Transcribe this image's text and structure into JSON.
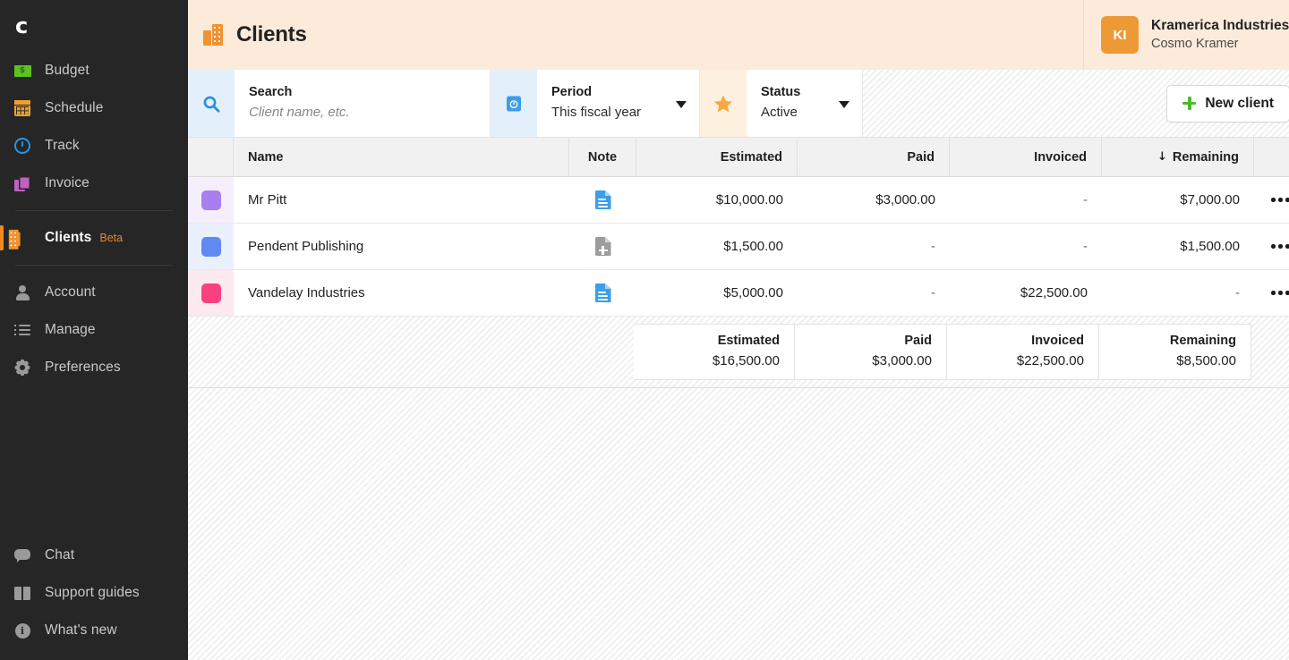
{
  "sidebar": {
    "logo": "c",
    "primary_items": [
      {
        "label": "Budget",
        "icon": "money-icon"
      },
      {
        "label": "Schedule",
        "icon": "calendar-icon"
      },
      {
        "label": "Track",
        "icon": "stopwatch-icon"
      },
      {
        "label": "Invoice",
        "icon": "invoice-icon"
      }
    ],
    "active_item": {
      "label": "Clients",
      "badge": "Beta",
      "icon": "building-icon"
    },
    "secondary_items": [
      {
        "label": "Account",
        "icon": "person-icon"
      },
      {
        "label": "Manage",
        "icon": "list-icon"
      },
      {
        "label": "Preferences",
        "icon": "gear-icon"
      }
    ],
    "bottom_items": [
      {
        "label": "Chat",
        "icon": "chat-icon"
      },
      {
        "label": "Support guides",
        "icon": "book-icon"
      },
      {
        "label": "What's new",
        "icon": "info-icon"
      }
    ]
  },
  "header": {
    "title": "Clients",
    "org_initials": "KI",
    "org_name": "Kramerica Industries",
    "user_name": "Cosmo Kramer"
  },
  "filters": {
    "search": {
      "label": "Search",
      "placeholder": "Client name, etc.",
      "value": ""
    },
    "period": {
      "label": "Period",
      "value": "This fiscal year"
    },
    "status": {
      "label": "Status",
      "value": "Active"
    },
    "new_client_label": "New client"
  },
  "table": {
    "columns": {
      "name": "Name",
      "note": "Note",
      "estimated": "Estimated",
      "paid": "Paid",
      "invoiced": "Invoiced",
      "remaining": "Remaining"
    },
    "sort": {
      "column": "remaining",
      "arrow": "↓"
    },
    "rows": [
      {
        "color": "#a97ff0",
        "color_tint": "#f4eefd",
        "name": "Mr Pitt",
        "note_state": "has-note",
        "note_color": "#3c9de8",
        "estimated": "$10,000.00",
        "paid": "$3,000.00",
        "invoiced": "-",
        "remaining": "$7,000.00"
      },
      {
        "color": "#6289f2",
        "color_tint": "#eaf0fe",
        "name": "Pendent Publishing",
        "note_state": "add-note",
        "note_color": "#9d9d9d",
        "estimated": "$1,500.00",
        "paid": "-",
        "invoiced": "-",
        "remaining": "$1,500.00"
      },
      {
        "color": "#fa4080",
        "color_tint": "#fdeaf1",
        "name": "Vandelay Industries",
        "note_state": "has-note",
        "note_color": "#3c9de8",
        "estimated": "$5,000.00",
        "paid": "-",
        "invoiced": "$22,500.00",
        "remaining": "-"
      }
    ],
    "totals": {
      "estimated_label": "Estimated",
      "estimated_value": "$16,500.00",
      "paid_label": "Paid",
      "paid_value": "$3,000.00",
      "invoiced_label": "Invoiced",
      "invoiced_value": "$22,500.00",
      "remaining_label": "Remaining",
      "remaining_value": "$8,500.00"
    }
  },
  "colors": {
    "sidebar_bg": "#262626",
    "accent_orange": "#ef8a21",
    "header_bg": "#fcebdb",
    "green": "#4fb92e",
    "blue": "#3c9de8"
  }
}
